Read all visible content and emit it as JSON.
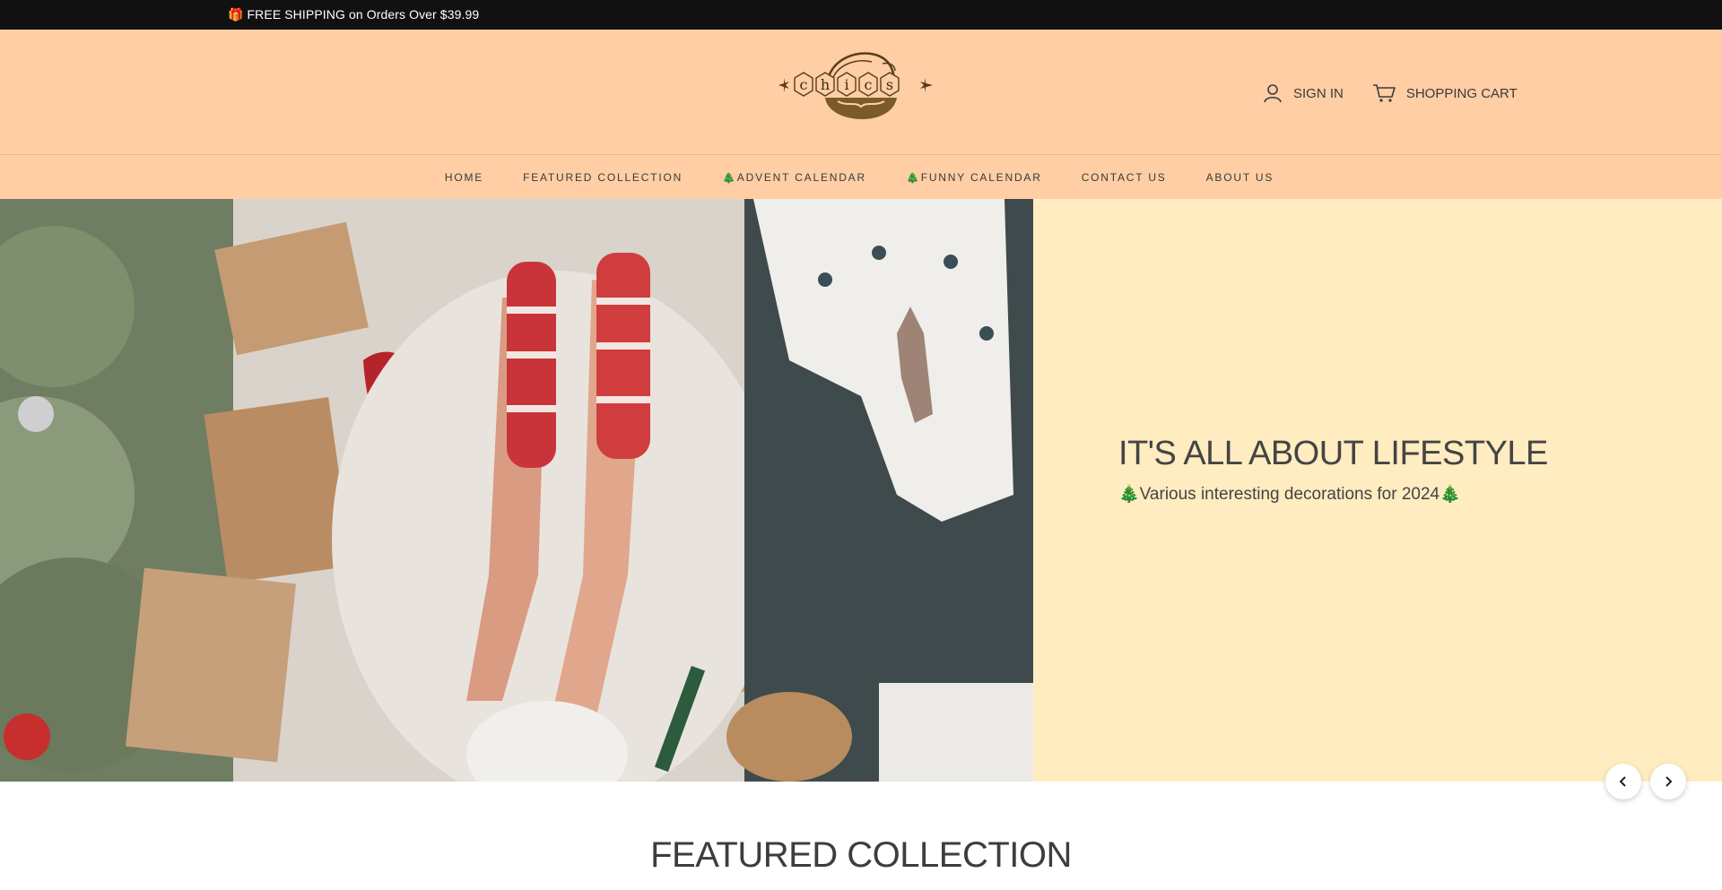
{
  "announcement": {
    "text": "🎁 FREE SHIPPING on Orders Over $39.99"
  },
  "header": {
    "logo_text": "chics",
    "sign_in": {
      "label": "SIGN IN",
      "icon": "user-icon"
    },
    "cart": {
      "label": "SHOPPING CART",
      "icon": "cart-icon"
    }
  },
  "nav": {
    "items": [
      {
        "label": "HOME"
      },
      {
        "label": "FEATURED COLLECTION"
      },
      {
        "label": "🎄ADVENT CALENDAR"
      },
      {
        "label": "🎄FUNNY CALENDAR"
      },
      {
        "label": "CONTACT US"
      },
      {
        "label": "ABOUT US"
      }
    ]
  },
  "hero": {
    "title": "IT'S ALL ABOUT LIFESTYLE",
    "subtitle": "🎄Various interesting decorations for 2024🎄",
    "prev_icon": "chevron-left-icon",
    "next_icon": "chevron-right-icon"
  },
  "sections": {
    "featured_title": "FEATURED COLLECTION"
  },
  "colors": {
    "announcement_bg": "#111111",
    "header_bg": "#ffcea4",
    "hero_copy_bg": "#ffecc0",
    "text": "#3a3a3a"
  }
}
